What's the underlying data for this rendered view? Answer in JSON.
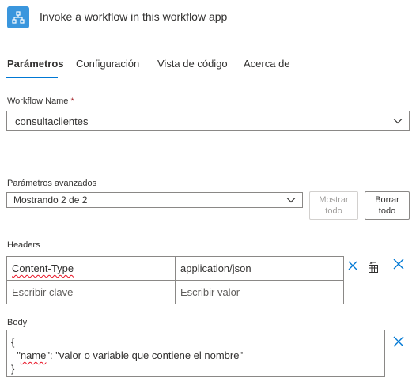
{
  "header": {
    "title": "Invoke a workflow in this workflow app",
    "icon": "workflow-hierarchy-icon",
    "icon_color": "#3a96dd"
  },
  "tabs": [
    {
      "label": "Parámetros",
      "active": true
    },
    {
      "label": "Configuración",
      "active": false
    },
    {
      "label": "Vista de código",
      "active": false
    },
    {
      "label": "Acerca de",
      "active": false
    }
  ],
  "workflow_name": {
    "label": "Workflow Name",
    "required_mark": "*",
    "value": "consultaclientes"
  },
  "advanced": {
    "label": "Parámetros avanzados",
    "value": "Mostrando 2 de 2",
    "show_all_label": "Mostrar todo",
    "clear_all_label": "Borrar todo"
  },
  "headers": {
    "label": "Headers",
    "rows": [
      {
        "key": "Content-Type",
        "value": "application/json"
      }
    ],
    "key_placeholder": "Escribir clave",
    "value_placeholder": "Escribir valor"
  },
  "body": {
    "label": "Body",
    "line1": "{",
    "line2_prefix": "  \"",
    "line2_key": "name",
    "line2_rest": "\": \"valor o variable que contiene el nombre\"",
    "line3": "}"
  },
  "colors": {
    "accent": "#0078d4",
    "required": "#a4262c",
    "spellcheck": "#e81123"
  }
}
